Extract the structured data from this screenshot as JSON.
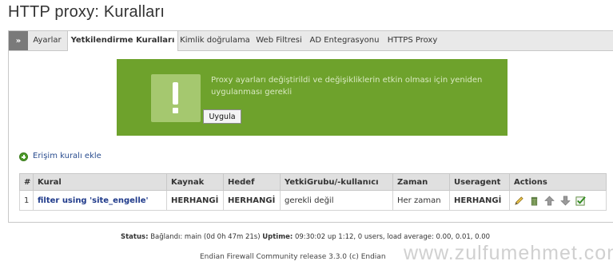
{
  "page": {
    "title": "HTTP proxy: Kuralları"
  },
  "tabs": [
    {
      "label": "Ayarlar",
      "active": false
    },
    {
      "label": "Yetkilendirme Kuralları",
      "active": true
    },
    {
      "label": "Kimlik doğrulama",
      "active": false
    },
    {
      "label": "Web Filtresi",
      "active": false
    },
    {
      "label": "AD Entegrasyonu",
      "active": false
    },
    {
      "label": "HTTPS Proxy",
      "active": false
    }
  ],
  "tab_toggle": "»",
  "notice": {
    "message": "Proxy ayarları değiştirildi ve değişikliklerin etkin olması için yeniden uygulanması gerekli",
    "apply_label": "Uygula",
    "bg_color": "#6ea22c"
  },
  "add_rule": {
    "label": "Erişim kuralı ekle"
  },
  "table": {
    "headers": [
      "#",
      "Kural",
      "Kaynak",
      "Hedef",
      "YetkiGrubu/-kullanıcı",
      "Zaman",
      "Useragent",
      "Actions"
    ],
    "rows": [
      {
        "num": "1",
        "rule": "filter using 'site_engelle'",
        "source": "HERHANGİ",
        "destination": "HERHANGİ",
        "auth_group": "gerekli değil",
        "time": "Her zaman",
        "useragent": "HERHANGİ",
        "actions": [
          "edit-icon",
          "delete-icon",
          "move-up-icon",
          "move-down-icon",
          "enabled-checkbox-icon"
        ]
      }
    ]
  },
  "status": {
    "label": "Status:",
    "connection": "Bağlandı: main (0d 0h 47m 21s)",
    "uptime_label": "Uptime:",
    "uptime": "09:30:02 up 1:12, 0 users, load average: 0.00, 0.01, 0.00"
  },
  "footer": {
    "text": "Endian Firewall Community release 3.3.0 (c) Endian"
  },
  "watermark": "www.zulfumehmet.com"
}
